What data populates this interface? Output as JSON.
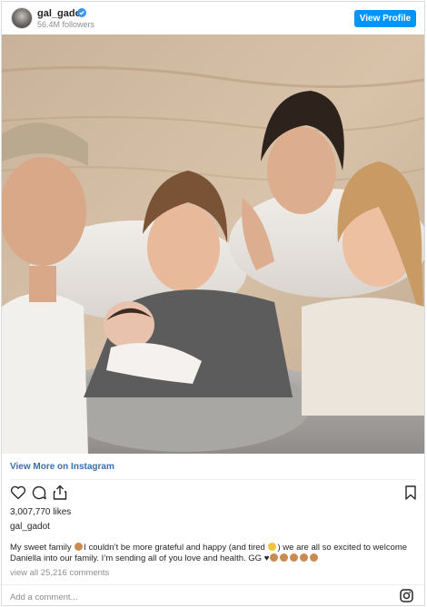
{
  "header": {
    "username": "gal_gadot",
    "followers": "56.4M followers",
    "view_profile_label": "View Profile"
  },
  "photo": {
    "description_icon": "family-photo"
  },
  "footer": {
    "view_more_label": "View More on Instagram",
    "likes": "3,007,770 likes",
    "poster": "gal_gadot",
    "caption_part1": "My sweet family ",
    "caption_part2": "I couldn’t be more grateful and happy (and tired ",
    "caption_part3": ") we are all so excited to welcome Daniella into our family. I’m sending all of you love and health. GG ♥",
    "view_comments": "view all 25,216 comments",
    "add_comment_placeholder": "Add a comment..."
  },
  "icons": {
    "like": "heart-icon",
    "comment": "comment-icon",
    "share": "share-icon",
    "save": "bookmark-icon",
    "instagram": "instagram-icon"
  },
  "colors": {
    "accent": "#0095f6",
    "link": "#3a6fa5",
    "muted": "#8e8e8e"
  }
}
